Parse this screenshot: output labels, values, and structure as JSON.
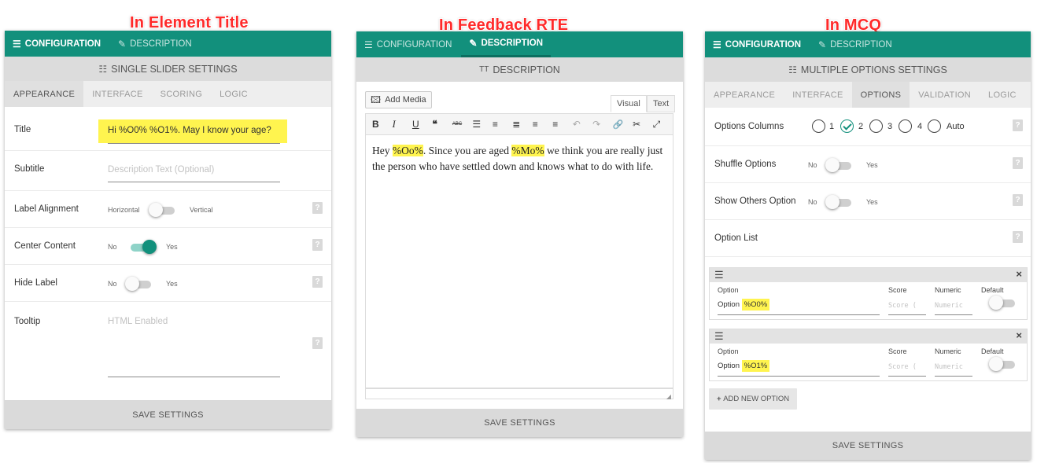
{
  "captions": {
    "left": "In Element Title",
    "middle": "In Feedback RTE",
    "right": "In MCQ"
  },
  "common": {
    "tab_configuration": "CONFIGURATION",
    "tab_description": "DESCRIPTION",
    "save_settings": "SAVE SETTINGS"
  },
  "slider_panel": {
    "section_title": "SINGLE SLIDER SETTINGS",
    "subtabs": [
      "APPEARANCE",
      "INTERFACE",
      "SCORING",
      "LOGIC"
    ],
    "title_label": "Title",
    "title_value_pre": "Hi ",
    "title_value_var": "%O0% %O1%",
    "title_value_post": ". May I know your age?",
    "subtitle_label": "Subtitle",
    "subtitle_placeholder": "Description Text (Optional)",
    "label_alignment_label": "Label Alignment",
    "label_alignment_off": "Horizontal",
    "label_alignment_on": "Vertical",
    "center_content_label": "Center Content",
    "center_content_on": true,
    "hide_label_label": "Hide Label",
    "hide_label_on": false,
    "no": "No",
    "yes": "Yes",
    "tooltip_label": "Tooltip",
    "tooltip_placeholder": "HTML Enabled",
    "help": "?"
  },
  "rte_panel": {
    "section_title": "DESCRIPTION",
    "add_media": "Add Media",
    "tab_visual": "Visual",
    "tab_text": "Text",
    "toolbar": [
      "B",
      "I",
      "U",
      "❝",
      "ABC",
      "☰",
      "≡",
      "≣",
      "≡",
      "≡",
      "↶",
      "↷",
      "🔗",
      "✂",
      "⤢"
    ],
    "body_pre": "Hey ",
    "body_var1": "%Oo%",
    "body_mid": ". Since you are aged ",
    "body_var2": "%Mo%",
    "body_post": " we think you are really just the person who have settled down and knows what to do with life."
  },
  "mcq_panel": {
    "section_title": "MULTIPLE OPTIONS SETTINGS",
    "subtabs": [
      "APPEARANCE",
      "INTERFACE",
      "OPTIONS",
      "VALIDATION",
      "LOGIC"
    ],
    "active_subtab": "OPTIONS",
    "options_columns_label": "Options Columns",
    "columns": [
      "1",
      "2",
      "3",
      "4",
      "Auto"
    ],
    "columns_selected": "2",
    "shuffle_label": "Shuffle Options",
    "show_others_label": "Show Others Option",
    "option_list_label": "Option List",
    "no": "No",
    "yes": "Yes",
    "help": "?",
    "option_header_labels": {
      "option": "Option",
      "score": "Score",
      "numeric": "Numeric",
      "default": "Default"
    },
    "score_placeholder": "Score (",
    "numeric_placeholder": "Numeric",
    "options": [
      {
        "prefix": "Option ",
        "var": "%O0%"
      },
      {
        "prefix": "Option ",
        "var": "%O1%"
      }
    ],
    "add_new_option": "ADD NEW OPTION"
  }
}
